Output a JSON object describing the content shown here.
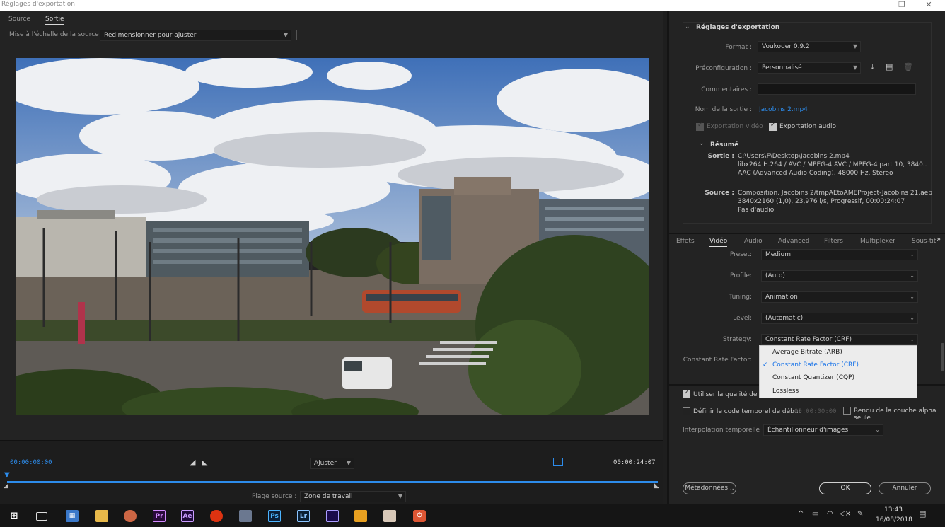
{
  "window": {
    "title": "Réglages d'exportation"
  },
  "left": {
    "tabs": [
      "Source",
      "Sortie"
    ],
    "scale_label": "Mise à l'échelle de la source :",
    "scale_value": "Redimensionner pour ajuster",
    "timecode_start": "00:00:00:00",
    "timecode_end": "00:00:24:07",
    "zoom_value": "Ajuster",
    "range_label": "Plage source :",
    "range_value": "Zone de travail"
  },
  "export": {
    "section_title": "Réglages d'exportation",
    "format_label": "Format :",
    "format_value": "Voukoder 0.9.2",
    "preset_label": "Préconfiguration :",
    "preset_value": "Personnalisé",
    "comments_label": "Commentaires :",
    "output_name_label": "Nom de la sortie :",
    "output_name_value": "Jacobins 2.mp4",
    "export_video_label": "Exportation vidéo",
    "export_audio_label": "Exportation audio",
    "summary_title": "Résumé",
    "output_label": "Sortie :",
    "output_lines": [
      "C:\\Users\\F\\Desktop\\Jacobins 2.mp4",
      "libx264 H.264 / AVC / MPEG-4 AVC / MPEG-4 part 10, 3840..",
      "AAC (Advanced Audio Coding), 48000 Hz, Stereo"
    ],
    "source_label": "Source :",
    "source_lines": [
      "Composition, Jacobins 2/tmpAEtoAMEProject-Jacobins 21.aep",
      "3840x2160 (1,0), 23,976 i/s, Progressif, 00:00:24:07",
      "Pas d'audio"
    ]
  },
  "subtabs": [
    "Effets",
    "Vidéo",
    "Audio",
    "Advanced",
    "Filters",
    "Multiplexer",
    "Sous-tit"
  ],
  "video": {
    "preset_label": "Preset:",
    "preset_value": "Medium",
    "profile_label": "Profile:",
    "profile_value": "(Auto)",
    "tuning_label": "Tuning:",
    "tuning_value": "Animation",
    "level_label": "Level:",
    "level_value": "(Automatic)",
    "strategy_label": "Strategy:",
    "strategy_value": "Constant Rate Factor (CRF)",
    "crf_label": "Constant Rate Factor:",
    "strategy_options": [
      "Average Bitrate (ARB)",
      "Constant Rate Factor (CRF)",
      "Constant Quantizer (CQP)",
      "Lossless"
    ]
  },
  "bottom": {
    "use_quality_label": "Utiliser la qualité de ren",
    "timecode_label": "Définir le code temporel de début",
    "timecode_value": "00:00:00:00",
    "alpha_label": "Rendu de la couche alpha seule",
    "interp_label": "Interpolation temporelle :",
    "interp_value": "Échantillonneur d'images",
    "metadata_button": "Métadonnées...",
    "ok_button": "OK",
    "cancel_button": "Annuler"
  },
  "taskbar": {
    "time": "13:43",
    "date": "16/08/2018"
  },
  "colors": {
    "accent": "#2d8ceb",
    "menu_selected": "#1a74e8"
  }
}
